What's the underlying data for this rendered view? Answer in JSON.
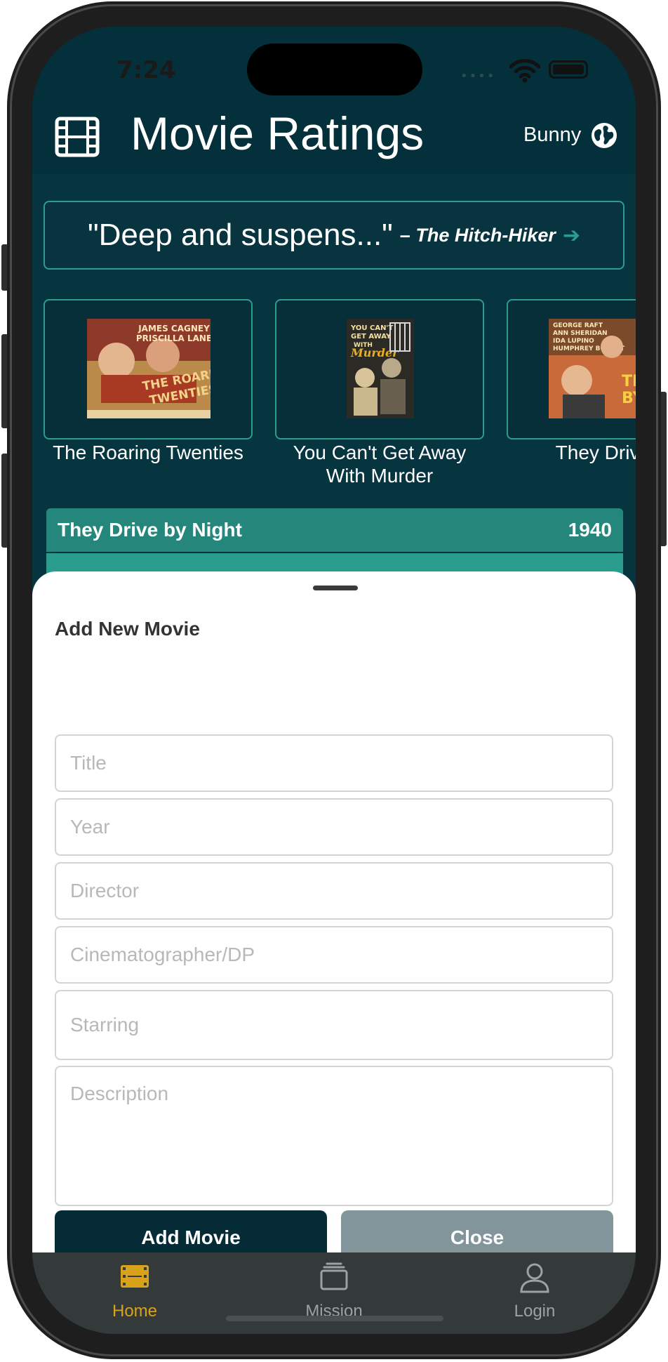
{
  "status_bar": {
    "time": "7:24"
  },
  "header": {
    "title": "Movie Ratings",
    "username": "Bunny"
  },
  "quote_banner": {
    "quote": "\"Deep and suspens...\"",
    "dash": "–",
    "movie": "The Hitch-Hiker"
  },
  "carousel": [
    {
      "title": "The Roaring Twenties"
    },
    {
      "title": "You Can't Get Away With Murder"
    },
    {
      "title": "They Drive b"
    }
  ],
  "selected_movie": {
    "title": "They Drive by Night",
    "year": "1940"
  },
  "add_movie_sheet": {
    "title": "Add New Movie",
    "fields": {
      "title": "Title",
      "year": "Year",
      "director": "Director",
      "cinematographer": "Cinematographer/DP",
      "starring": "Starring",
      "description": "Description"
    },
    "add_button": "Add Movie",
    "close_button": "Close"
  },
  "tab_bar": {
    "tabs": [
      {
        "label": "Home",
        "icon": "film-icon",
        "active": true
      },
      {
        "label": "Mission",
        "icon": "stack-icon",
        "active": false
      },
      {
        "label": "Login",
        "icon": "person-icon",
        "active": false
      }
    ]
  },
  "colors": {
    "header_bg": "#04303b",
    "accent_teal": "#2a9d8f",
    "row_teal": "#25877b",
    "primary_button": "#052b36",
    "secondary_button": "#82959a",
    "tab_active": "#d9a21b",
    "tab_inactive": "#9aa2a2"
  }
}
